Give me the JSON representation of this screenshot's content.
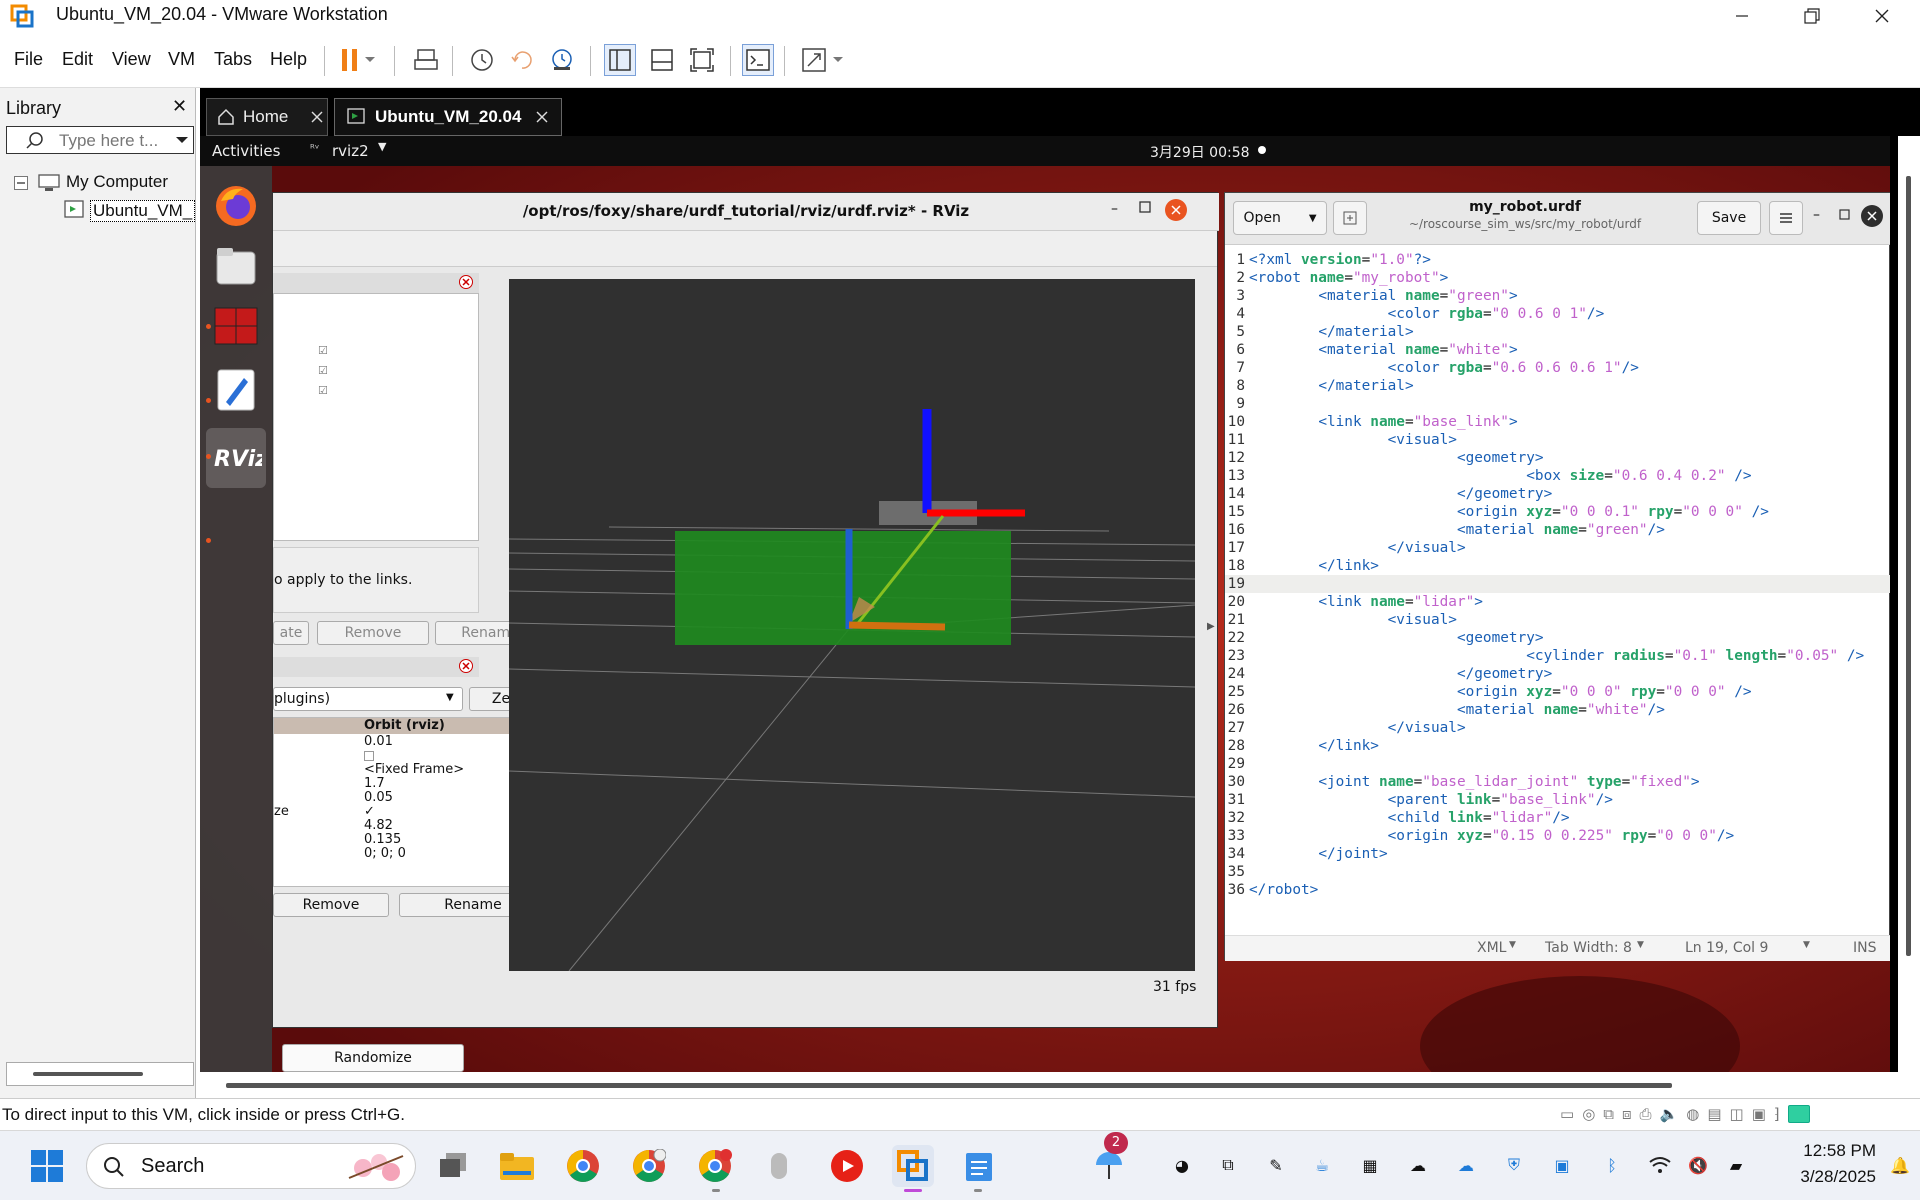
{
  "vmware": {
    "title": "Ubuntu_VM_20.04 - VMware Workstation",
    "menu": [
      "File",
      "Edit",
      "View",
      "VM",
      "Tabs",
      "Help"
    ],
    "status_message": "To direct input to this VM, click inside or press Ctrl+G."
  },
  "library": {
    "title": "Library",
    "search_placeholder": "Type here t...",
    "tree": [
      "My Computer",
      "Ubuntu_VM_"
    ]
  },
  "tabs": [
    {
      "label": "Home"
    },
    {
      "label": "Ubuntu_VM_20.04"
    }
  ],
  "ubuntu": {
    "activities": "Activities",
    "app_menu": "rviz2",
    "clock": "3月29日  00:58"
  },
  "rviz": {
    "title": "/opt/ros/foxy/share/urdf_tutorial/rviz/urdf.rviz* - RViz",
    "hint": "o apply to the links.",
    "buttons_top": [
      "ate",
      "Remove",
      "Rename"
    ],
    "view_type": "plugins)",
    "zero": "Zero",
    "props_header": "Orbit (rviz)",
    "props": [
      "0.01",
      "",
      "<Fixed Frame>",
      "1.7",
      "0.05",
      "✓",
      "4.82",
      "0.135",
      "0; 0; 0"
    ],
    "prop_label_ze": "ze",
    "buttons_bottom": [
      "Remove",
      "Rename"
    ],
    "randomize": "Randomize",
    "fps": "31 fps"
  },
  "gedit": {
    "open": "Open",
    "save": "Save",
    "filename": "my_robot.urdf",
    "path": "~/roscourse_sim_ws/src/my_robot/urdf",
    "status": {
      "lang": "XML",
      "tab": "Tab Width: 8",
      "pos": "Ln 19, Col 9",
      "mode": "INS"
    },
    "current_line": 19,
    "lines": [
      "<?xml version=\"1.0\"?>",
      "<robot name=\"my_robot\">",
      "        <material name=\"green\">",
      "                <color rgba=\"0 0.6 0 1\"/>",
      "        </material>",
      "        <material name=\"white\">",
      "                <color rgba=\"0.6 0.6 0.6 1\"/>",
      "        </material>",
      "",
      "        <link name=\"base_link\">",
      "                <visual>",
      "                        <geometry>",
      "                                <box size=\"0.6 0.4 0.2\" />",
      "                        </geometry>",
      "                        <origin xyz=\"0 0 0.1\" rpy=\"0 0 0\" />",
      "                        <material name=\"green\"/>",
      "                </visual>",
      "        </link>",
      "",
      "        <link name=\"lidar\">",
      "                <visual>",
      "                        <geometry>",
      "                                <cylinder radius=\"0.1\" length=\"0.05\" />",
      "                        </geometry>",
      "                        <origin xyz=\"0 0 0\" rpy=\"0 0 0\" />",
      "                        <material name=\"white\"/>",
      "                </visual>",
      "        </link>",
      "",
      "        <joint name=\"base_lidar_joint\" type=\"fixed\">",
      "                <parent link=\"base_link\"/>",
      "                <child link=\"lidar\"/>",
      "                <origin xyz=\"0.15 0 0.225\" rpy=\"0 0 0\"/>",
      "        </joint>",
      "",
      "</robot>"
    ]
  },
  "taskbar": {
    "search": "Search",
    "weather_badge": "2",
    "time": "12:58 PM",
    "date": "3/28/2025"
  },
  "colors": {
    "accent_orange": "#e95420",
    "vm_pause": "#f07f16",
    "desktop_red": "#7a1414",
    "rviz_bg": "#303030",
    "robot_green": "#1f8a1f"
  }
}
